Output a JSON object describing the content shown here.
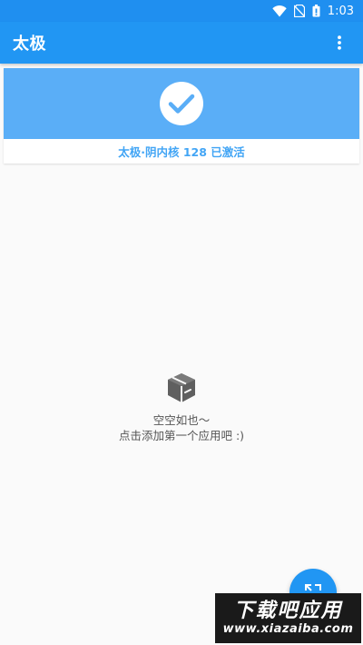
{
  "status_bar": {
    "time": "1:03",
    "icons": [
      "wifi-icon",
      "no-sim-icon",
      "battery-icon"
    ]
  },
  "app_bar": {
    "title": "太极",
    "menu_icon": "more-vert-icon"
  },
  "status_card": {
    "icon": "check-icon",
    "text": "太极·阴内核 128 已激活"
  },
  "empty_state": {
    "icon": "empty-box-icon",
    "line1": "空空如也～",
    "line2": "点击添加第一个应用吧 :)"
  },
  "fab": {
    "icon": "expand-icon"
  },
  "watermark": {
    "main": "下载吧应用",
    "sub": "www.xiazaiba.com"
  },
  "colors": {
    "primary": "#2196f3",
    "status_bar": "#1f8ff0",
    "banner": "#5aaef7",
    "card_text": "#42a5f5",
    "background": "#fafafa"
  }
}
